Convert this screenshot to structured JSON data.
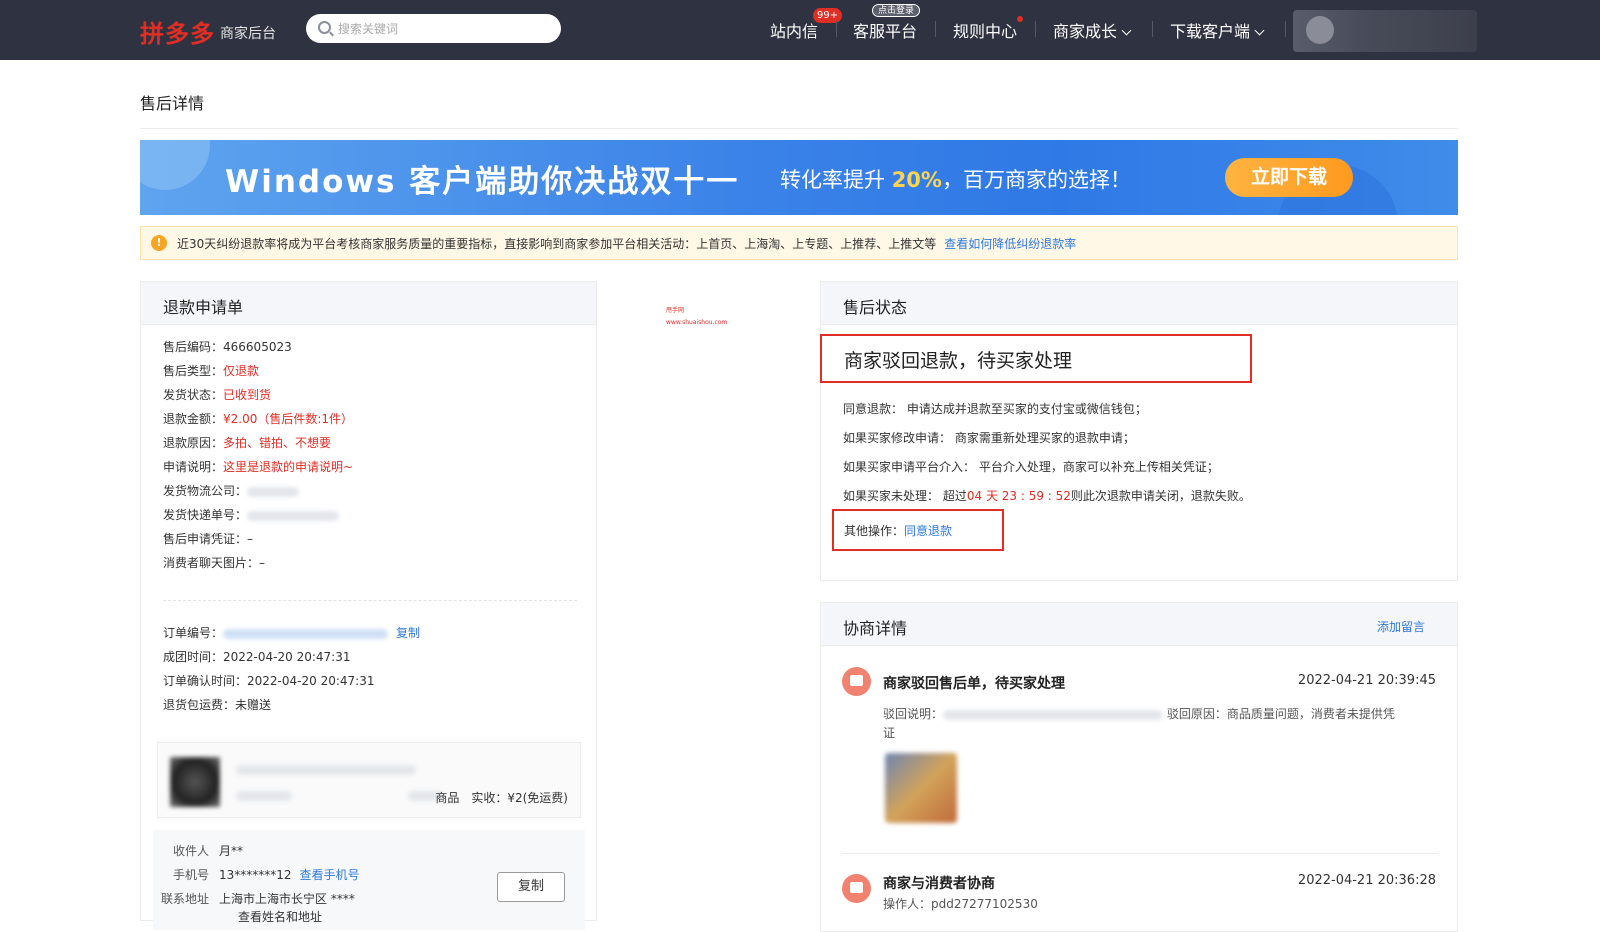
{
  "header": {
    "logo": "拼多多",
    "logo_sub": "商家后台",
    "search_placeholder": "搜索关键词",
    "nav": {
      "messages": "站内信",
      "messages_badge": "99+",
      "service": "客服平台",
      "service_badge": "点击登录",
      "rules": "规则中心",
      "growth": "商家成长",
      "download": "下载客户端"
    }
  },
  "page": {
    "title": "售后详情"
  },
  "banner": {
    "main": "Windows 客户端助你决战双十一",
    "sub_prefix": "转化率提升",
    "sub_pct": "20%",
    "sub_suffix": "，百万商家的选择！",
    "button": "立即下载"
  },
  "notice": {
    "text": "近30天纠纷退款率将成为平台考核商家服务质量的重要指标，直接影响到商家参加平台相关活动：上首页、上海淘、上专题、上推荐、上推文等",
    "link": "查看如何降低纠纷退款率"
  },
  "watermark": {
    "line1": "甩手网",
    "line2": "www.shuaishou.com"
  },
  "refund_form": {
    "title": "退款申请单",
    "fields": [
      {
        "label": "售后编码：",
        "value": "466605023"
      },
      {
        "label": "售后类型：",
        "value": "仅退款"
      },
      {
        "label": "发货状态：",
        "value": "已收到货"
      },
      {
        "label": "退款金额：",
        "value": "¥2.00（售后件数:1件）"
      },
      {
        "label": "退款原因：",
        "value": "多拍、错拍、不想要"
      },
      {
        "label": "申请说明：",
        "value": "这里是退款的申请说明~"
      },
      {
        "label": "发货物流公司：",
        "value": ""
      },
      {
        "label": "发货快递单号：",
        "value": ""
      },
      {
        "label": "售后申请凭证：",
        "value": "–"
      },
      {
        "label": "消费者聊天图片：",
        "value": "–"
      }
    ],
    "order": {
      "order_no_label": "订单编号：",
      "copy_link": "复制",
      "group_time_label": "成团时间：",
      "group_time": "2022-04-20 20:47:31",
      "confirm_time_label": "订单确认时间：",
      "confirm_time": "2022-04-20 20:47:31",
      "return_shipping_label": "退货包运费：",
      "return_shipping": "未赠送"
    },
    "goods": {
      "meta": "商品　实收：¥2(免运费)"
    },
    "address": {
      "receiver_label": "收件人",
      "receiver": "月**",
      "phone_label": "手机号",
      "phone": "13*******12",
      "phone_link": "查看手机号",
      "addr_label": "联系地址",
      "addr": "上海市上海市长宁区 ****",
      "addr_link": "查看姓名和地址",
      "copy_button": "复制"
    }
  },
  "after_sale_status": {
    "title": "售后状态",
    "status": "商家驳回退款，待买家处理",
    "rules": [
      {
        "label": "同意退款：",
        "text": "申请达成并退款至买家的支付宝或微信钱包；"
      },
      {
        "label": "如果买家修改申请：",
        "text": "商家需重新处理买家的退款申请；"
      },
      {
        "label": "如果买家申请平台介入：",
        "text": "平台介入处理，商家可以补充上传相关凭证；"
      }
    ],
    "timeout_label": "如果买家未处理：",
    "timeout_prefix": "超过",
    "timeout_value": "04 天 23 : 59 : 52",
    "timeout_suffix": "则此次退款申请关闭，退款失败。",
    "other_ops_label": "其他操作：",
    "agree_refund": "同意退款"
  },
  "negotiation": {
    "title": "协商详情",
    "add_message": "添加留言",
    "items": [
      {
        "title": "商家驳回售后单，待买家处理",
        "time": "2022-04-21 20:39:45",
        "desc_label": "驳回说明：",
        "reason_label": "驳回原因：",
        "reason": "商品质量问题，消费者未提供凭证"
      },
      {
        "title": "商家与消费者协商",
        "time": "2022-04-21 20:36:28",
        "operator": "操作人：pdd27277102530"
      }
    ]
  }
}
